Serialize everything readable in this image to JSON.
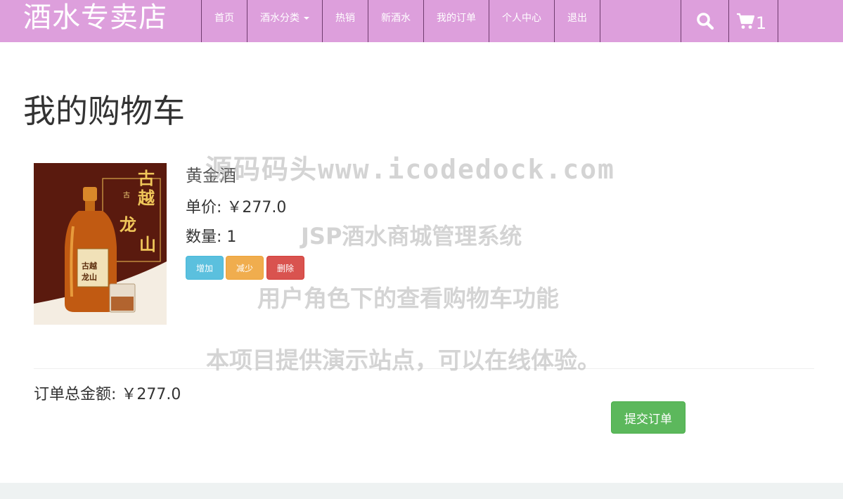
{
  "navbar": {
    "brand": "酒水专卖店",
    "items": [
      {
        "label": "首页"
      },
      {
        "label": "酒水分类"
      },
      {
        "label": "热销"
      },
      {
        "label": "新酒水"
      },
      {
        "label": "我的订单"
      },
      {
        "label": "个人中心"
      },
      {
        "label": "退出"
      }
    ],
    "search_icon": "search-icon",
    "cart_icon": "cart-icon",
    "cart_count": "1"
  },
  "page": {
    "title": "我的购物车"
  },
  "cart": {
    "items": [
      {
        "name": "黄金酒",
        "unit_price": "单价: ￥277.0",
        "quantity": "数量: 1",
        "image_label": "古越龙山"
      }
    ],
    "buttons": {
      "add": "增加",
      "minus": "减少",
      "delete": "删除"
    },
    "total": "订单总金额: ￥277.0",
    "submit": "提交订单"
  },
  "watermark": {
    "line1": "源码码头www.icodedock.com",
    "line2": "JSP酒水商城管理系统",
    "line3": "用户角色下的查看购物车功能",
    "line4": "本项目提供演示站点，可以在线体验。"
  },
  "colors": {
    "navbar": "#dd9fdc",
    "info": "#5bc0de",
    "warning": "#f0ad4e",
    "danger": "#d9534f",
    "success": "#5cb85c"
  }
}
